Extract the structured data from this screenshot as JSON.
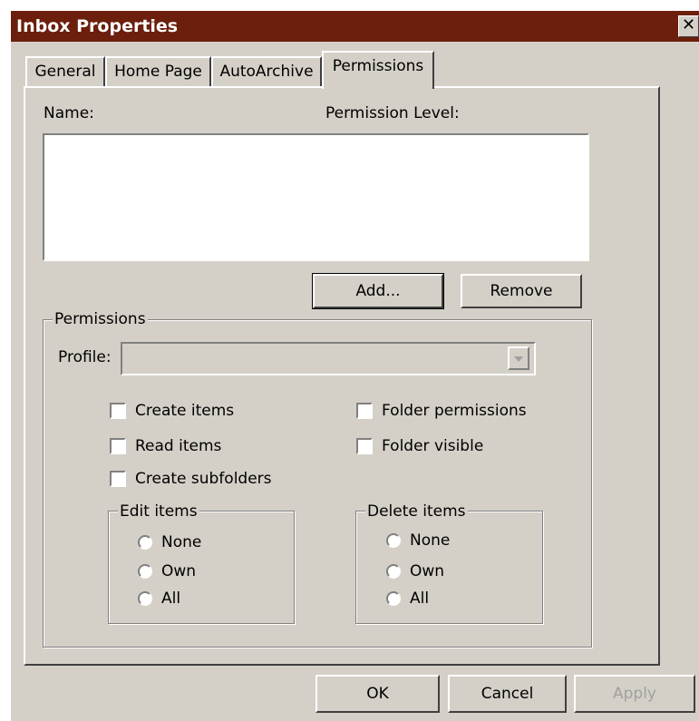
{
  "window": {
    "title": "Inbox Properties",
    "close_glyph": "✕"
  },
  "tabs": [
    "General",
    "Home Page",
    "AutoArchive",
    "Permissions"
  ],
  "active_tab": "Permissions",
  "list": {
    "name_header": "Name:",
    "level_header": "Permission Level:"
  },
  "list_buttons": {
    "add": "Add...",
    "remove": "Remove"
  },
  "permissions": {
    "group_label": "Permissions",
    "profile_label": "Profile:",
    "profile_value": "",
    "checkboxes": {
      "create_items": "Create items",
      "read_items": "Read items",
      "create_subfolders": "Create subfolders",
      "folder_permissions": "Folder permissions",
      "folder_visible": "Folder visible"
    },
    "edit_items": {
      "label": "Edit items",
      "none": "None",
      "own": "Own",
      "all": "All"
    },
    "delete_items": {
      "label": "Delete items",
      "none": "None",
      "own": "Own",
      "all": "All"
    }
  },
  "footer": {
    "ok": "OK",
    "cancel": "Cancel",
    "apply": "Apply"
  },
  "colors": {
    "titlebar": "#6b1f0c",
    "face": "#d4d0c8",
    "disabled_text": "#a0a0a0"
  },
  "icons": {
    "dropdown": "chevron-down-icon",
    "close": "close-icon"
  }
}
